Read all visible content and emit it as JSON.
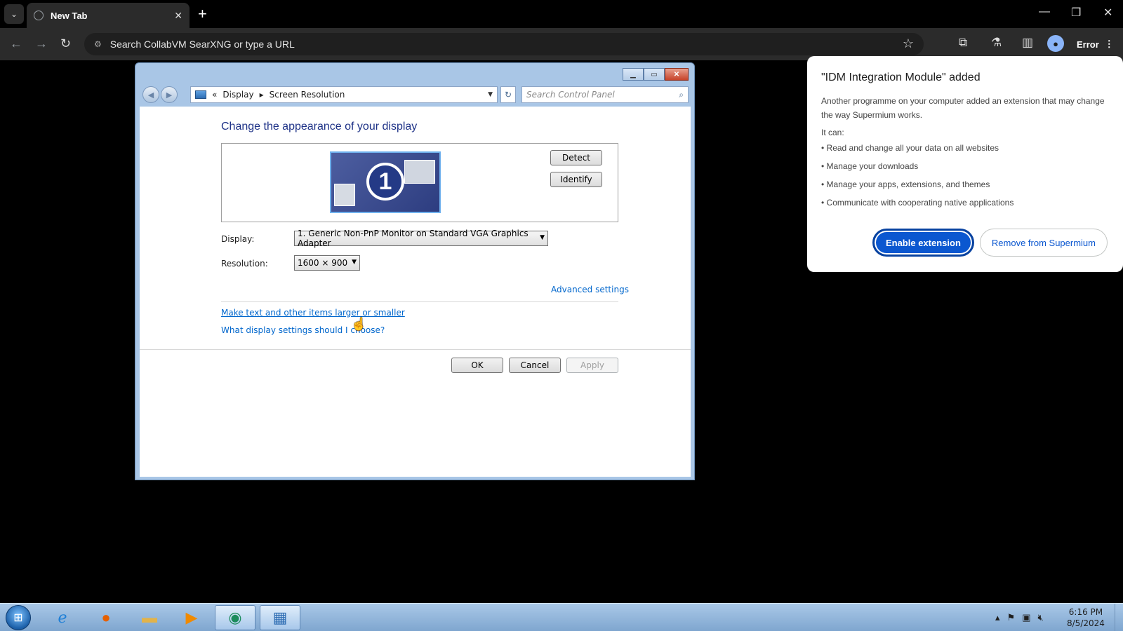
{
  "browser": {
    "tab_title": "New Tab",
    "omnibox_placeholder": "Search CollabVM SearXNG or type a URL",
    "error_label": "Error"
  },
  "control_panel": {
    "breadcrumb": [
      "Display",
      "Screen Resolution"
    ],
    "search_placeholder": "Search Control Panel",
    "heading": "Change the appearance of your display",
    "monitor_number": "1",
    "detect_label": "Detect",
    "identify_label": "Identify",
    "display_label": "Display:",
    "display_value": "1. Generic Non-PnP Monitor on Standard VGA Graphics Adapter",
    "resolution_label": "Resolution:",
    "resolution_value": "1600 × 900",
    "advanced_link": "Advanced settings",
    "text_size_link": "Make text and other items larger or smaller",
    "help_link": "What display settings should I choose?",
    "ok_label": "OK",
    "cancel_label": "Cancel",
    "apply_label": "Apply"
  },
  "popup": {
    "title": "\"IDM Integration Module\" added",
    "body": "Another programme on your computer added an extension that may change the way Supermium works.",
    "caption": "It can:",
    "permissions": [
      "• Read and change all your data on all websites",
      "• Manage your downloads",
      "• Manage your apps, extensions, and themes",
      "• Communicate with cooperating native applications"
    ],
    "enable_label": "Enable extension",
    "remove_label": "Remove from Supermium",
    "primary_color": "#0b57d0"
  },
  "taskbar": {
    "time": "6:16 PM",
    "date": "8/5/2024",
    "apps": [
      "start-orb",
      "internet-explorer-icon",
      "firefox-icon",
      "file-explorer-icon",
      "media-player-icon",
      "supermium-icon",
      "control-panel-icon"
    ]
  }
}
